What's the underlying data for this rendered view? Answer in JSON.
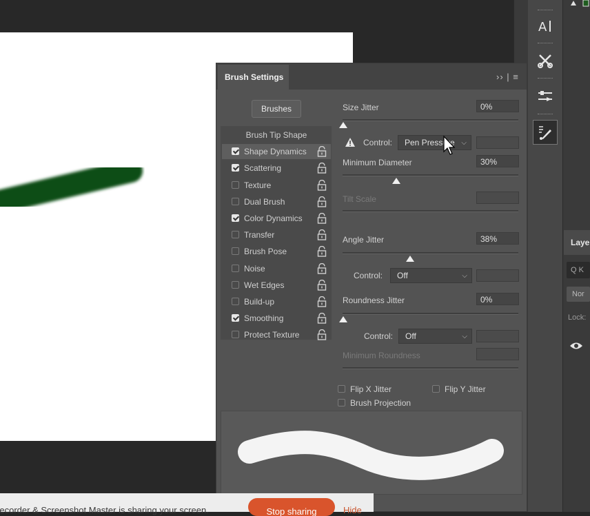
{
  "panel": {
    "title": "Brush Settings",
    "menu_glyph": "›› | ≡",
    "brushes_button": "Brushes"
  },
  "brush_options": [
    {
      "label": "Brush Tip Shape",
      "type": "header"
    },
    {
      "label": "Shape Dynamics",
      "checked": true,
      "active": true
    },
    {
      "label": "Scattering",
      "checked": true
    },
    {
      "label": "Texture",
      "checked": false
    },
    {
      "label": "Dual Brush",
      "checked": false
    },
    {
      "label": "Color Dynamics",
      "checked": true
    },
    {
      "label": "Transfer",
      "checked": false
    },
    {
      "label": "Brush Pose",
      "checked": false
    },
    {
      "label": "Noise",
      "checked": false
    },
    {
      "label": "Wet Edges",
      "checked": false
    },
    {
      "label": "Build-up",
      "checked": false
    },
    {
      "label": "Smoothing",
      "checked": true
    },
    {
      "label": "Protect Texture",
      "checked": false
    }
  ],
  "shape_dynamics": {
    "size_jitter": {
      "label": "Size Jitter",
      "value": "0%",
      "level": 0
    },
    "size_control": {
      "label": "Control:",
      "value": "Pen Pressure"
    },
    "minimum_diameter": {
      "label": "Minimum Diameter",
      "value": "30%",
      "level": 30
    },
    "tilt_scale": {
      "label": "Tilt Scale"
    },
    "angle_jitter": {
      "label": "Angle Jitter",
      "value": "38%",
      "level": 38
    },
    "angle_control": {
      "label": "Control:",
      "value": "Off"
    },
    "roundness_jitter": {
      "label": "Roundness Jitter",
      "value": "0%",
      "level": 0
    },
    "roundness_control": {
      "label": "Control:",
      "value": "Off"
    },
    "minimum_roundness": {
      "label": "Minimum Roundness"
    },
    "flip_x": {
      "label": "Flip X Jitter",
      "checked": false
    },
    "flip_y": {
      "label": "Flip Y Jitter",
      "checked": false
    },
    "brush_projection": {
      "label": "Brush Projection",
      "checked": false
    }
  },
  "layers_panel": {
    "tab": "Layers",
    "search": "Q K",
    "mode": "Nor",
    "lock": "Lock:"
  },
  "share_bar": {
    "text": "Recorder & Screenshot Master is sharing your screen.",
    "stop_button": "Stop sharing",
    "hide_link": "Hide"
  },
  "colors": {
    "stroke": "#0f4d12",
    "panel_bg": "#535353",
    "accent_stop": "#d9542c"
  }
}
